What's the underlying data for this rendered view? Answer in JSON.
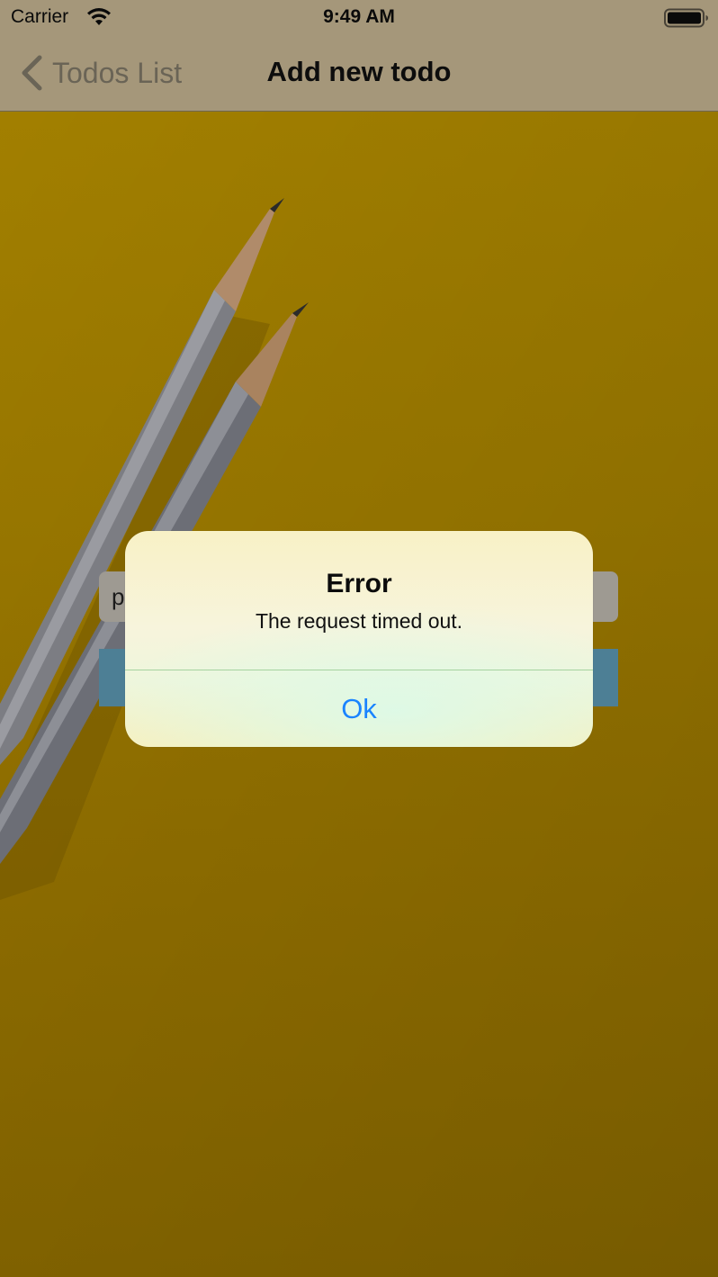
{
  "status_bar": {
    "carrier": "Carrier",
    "time": "9:49 AM",
    "wifi_icon": "wifi-icon",
    "battery_icon": "battery-full-icon"
  },
  "nav": {
    "back_label": "Todos List",
    "back_icon": "chevron-left-icon",
    "title": "Add new todo"
  },
  "form": {
    "input_value": "p",
    "input_placeholder": "",
    "add_button_label": ""
  },
  "alert": {
    "title": "Error",
    "message": "The request timed out.",
    "ok_label": "Ok"
  },
  "colors": {
    "background": "#9b7900",
    "nav_bar": "#a5977a",
    "button": "#4d7f95",
    "alert_action": "#1a84ff"
  }
}
